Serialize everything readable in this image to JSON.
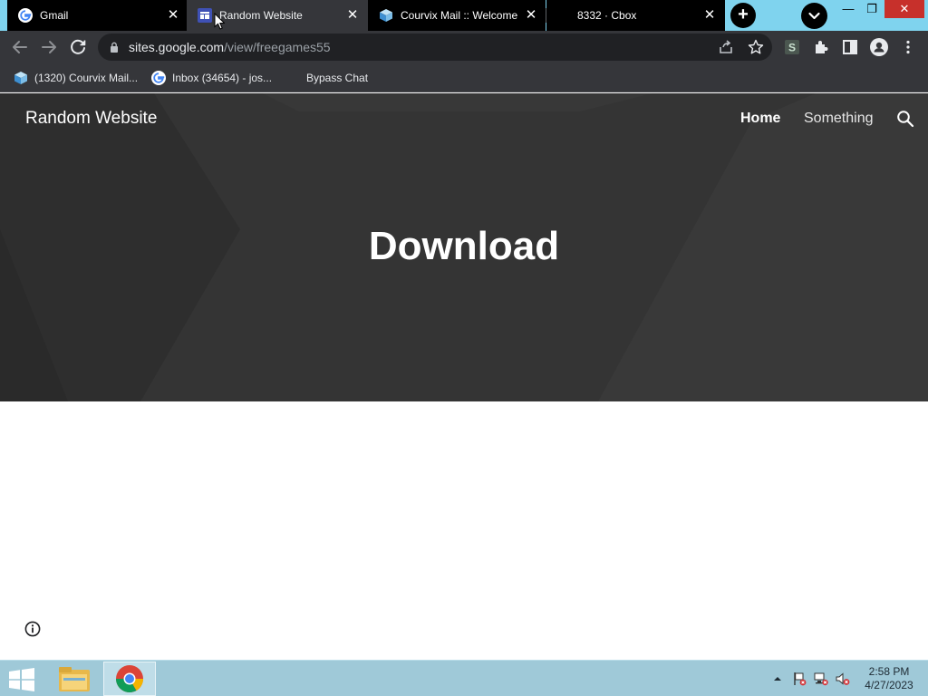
{
  "browser": {
    "tabs": [
      {
        "title": "Gmail",
        "favicon": "google-g-icon",
        "active": false
      },
      {
        "title": "Random Website",
        "favicon": "google-sites-icon",
        "active": true
      },
      {
        "title": "Courvix Mail :: Welcome",
        "favicon": "courvix-cube-icon",
        "active": false
      },
      {
        "title": "8332 · Cbox",
        "favicon": "none",
        "active": false
      }
    ],
    "address_bar": {
      "host": "sites.google.com",
      "path": "/view/freegames55"
    },
    "bookmarks": [
      {
        "label": "(1320) Courvix Mail...",
        "favicon": "courvix-cube-icon"
      },
      {
        "label": "Inbox (34654) - jos...",
        "favicon": "google-g-icon"
      },
      {
        "label": "Bypass Chat",
        "favicon": "none"
      }
    ],
    "window_controls": {
      "minimize": "—",
      "restore": "❐",
      "close": "✕"
    }
  },
  "page": {
    "site_title": "Random Website",
    "nav": [
      {
        "label": "Home",
        "active": true
      },
      {
        "label": "Something",
        "active": false
      }
    ],
    "heading": "Download"
  },
  "taskbar": {
    "clock_time": "2:58 PM",
    "clock_date": "4/27/2023"
  },
  "colors": {
    "tab_strip": "#7fd3ee",
    "toolbar": "#35363a",
    "hero_bg": "#343434",
    "taskbar": "#9fc9d8",
    "close_red": "#c7302b"
  }
}
